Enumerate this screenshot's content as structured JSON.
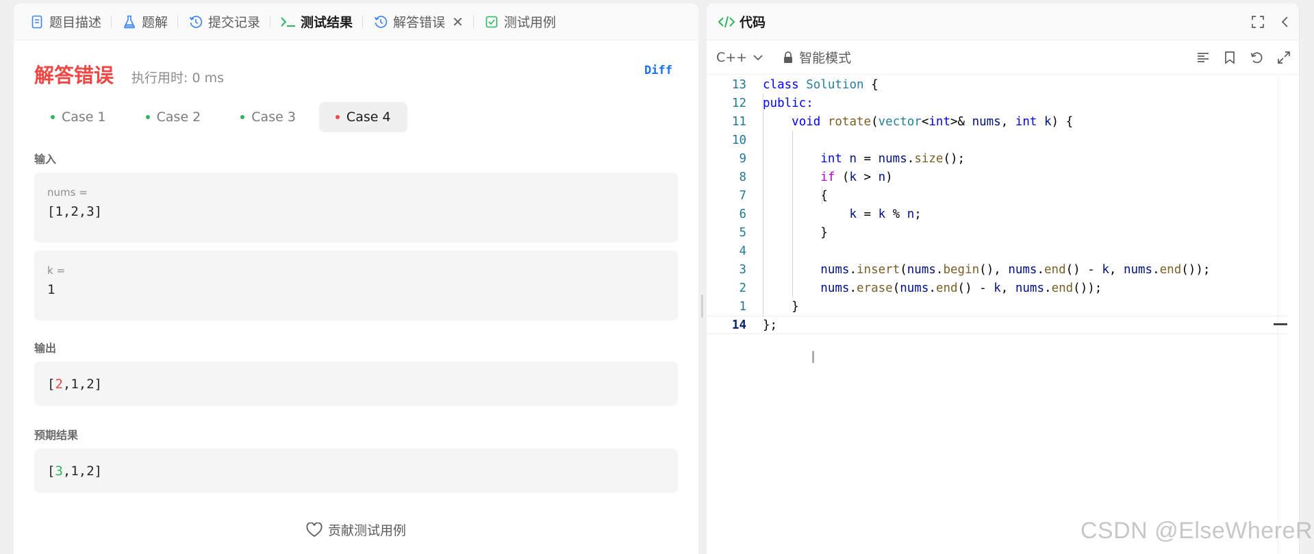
{
  "tabs": [
    {
      "label": "题目描述",
      "icon": "document-icon"
    },
    {
      "label": "题解",
      "icon": "flask-icon"
    },
    {
      "label": "提交记录",
      "icon": "history-icon"
    },
    {
      "label": "测试结果",
      "icon": "terminal-icon"
    },
    {
      "label": "解答错误",
      "icon": "history-icon"
    },
    {
      "label": "测试用例",
      "icon": "checkbox-icon"
    }
  ],
  "result": {
    "status": "解答错误",
    "runtime": "执行用时: 0 ms",
    "diff_label": "Diff",
    "status_color": "#ef4743"
  },
  "cases": [
    "Case 1",
    "Case 2",
    "Case 3",
    "Case 4"
  ],
  "input_label": "输入",
  "inputs": [
    {
      "name": "nums =",
      "value": "[1,2,3]"
    },
    {
      "name": "k =",
      "value": "1"
    }
  ],
  "output_label": "输出",
  "output": {
    "open": "[",
    "diff": "2",
    "rest": ",1,2]"
  },
  "expected_label": "预期结果",
  "expected": {
    "open": "[",
    "diff": "3",
    "rest": ",1,2]"
  },
  "contribute_label": "贡献测试用例",
  "code_panel": {
    "title": "代码",
    "language": "C++",
    "mode": "智能模式"
  },
  "code_lines": [
    {
      "ln": "13",
      "html": "<span class=\"kw\">class</span> <span class=\"cls\">Solution</span> {"
    },
    {
      "ln": "12",
      "html": "<span class=\"kw\">public:</span>"
    },
    {
      "ln": "11",
      "html": "    <span class=\"kw\">void</span> <span class=\"fn\">rotate</span>(<span class=\"cls\">vector</span>&lt;<span class=\"kw\">int</span>&gt;&amp; <span class=\"var\">nums</span>, <span class=\"kw\">int</span> <span class=\"var\">k</span>) {"
    },
    {
      "ln": "10",
      "html": ""
    },
    {
      "ln": "9",
      "html": "        <span class=\"kw\">int</span> <span class=\"var\">n</span> = <span class=\"var\">nums</span>.<span class=\"fn\">size</span>();"
    },
    {
      "ln": "8",
      "html": "        <span class=\"ctrl\">if</span> (<span class=\"var\">k</span> &gt; <span class=\"var\">n</span>)"
    },
    {
      "ln": "7",
      "html": "        {"
    },
    {
      "ln": "6",
      "html": "            <span class=\"var\">k</span> = <span class=\"var\">k</span> % <span class=\"var\">n</span>;"
    },
    {
      "ln": "5",
      "html": "        }"
    },
    {
      "ln": "4",
      "html": ""
    },
    {
      "ln": "3",
      "html": "        <span class=\"var\">nums</span>.<span class=\"fn\">insert</span>(<span class=\"var\">nums</span>.<span class=\"fn\">begin</span>(), <span class=\"var\">nums</span>.<span class=\"fn\">end</span>() - <span class=\"var\">k</span>, <span class=\"var\">nums</span>.<span class=\"fn\">end</span>());"
    },
    {
      "ln": "2",
      "html": "        <span class=\"var\">nums</span>.<span class=\"fn\">erase</span>(<span class=\"var\">nums</span>.<span class=\"fn\">end</span>() - <span class=\"var\">k</span>, <span class=\"var\">nums</span>.<span class=\"fn\">end</span>());"
    },
    {
      "ln": "1",
      "html": "    }"
    },
    {
      "ln": "14",
      "html": "};",
      "current": true
    }
  ],
  "watermark": "CSDN @ElseWhereR"
}
